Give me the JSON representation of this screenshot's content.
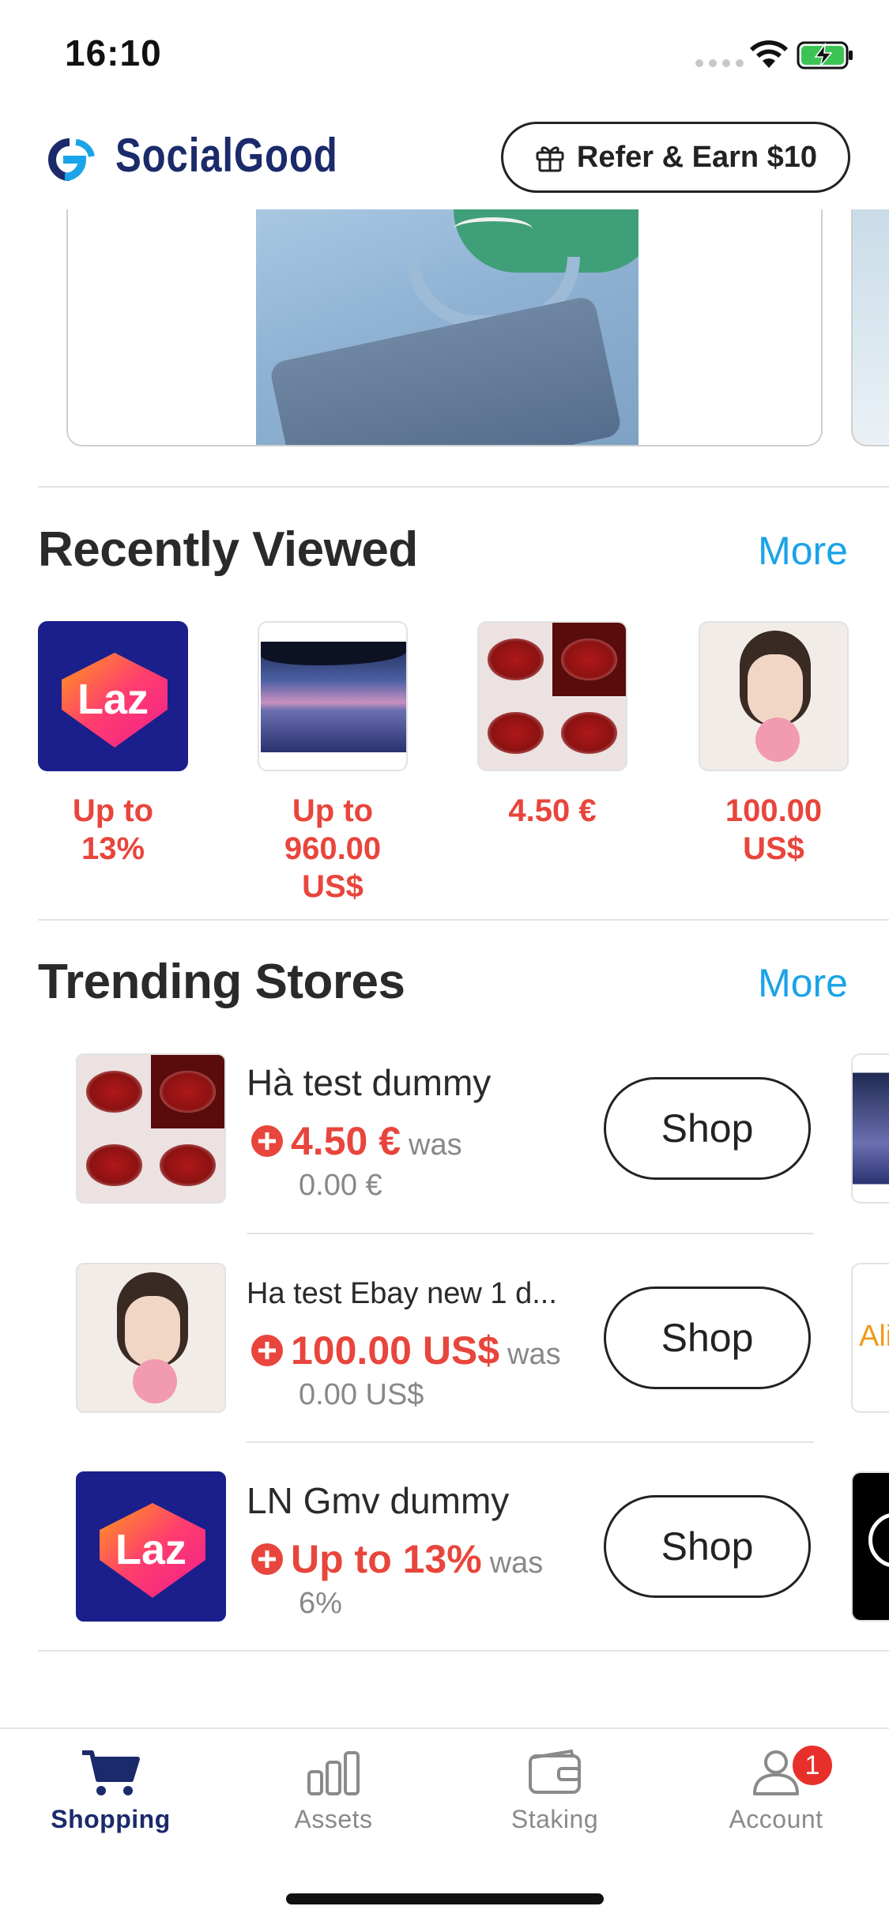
{
  "status_bar": {
    "time": "16:10"
  },
  "header": {
    "brand": "SocialGood",
    "refer_label": "Refer & Earn $10"
  },
  "recently_viewed": {
    "title": "Recently Viewed",
    "more_label": "More",
    "items": [
      {
        "thumb": "lazada-logo",
        "thumb_text": "Laz",
        "price": "Up to 13%"
      },
      {
        "thumb": "lake-sunset-photo",
        "price": "Up to 960.00 US$"
      },
      {
        "thumb": "red-lipstick-photo",
        "price": "4.50 €"
      },
      {
        "thumb": "woman-with-flower-photo",
        "price": "100.00 US$"
      }
    ]
  },
  "trending_stores": {
    "title": "Trending Stores",
    "more_label": "More",
    "stores": [
      {
        "thumb": "red-lipstick-photo",
        "name": "Hà test dummy",
        "price": "4.50 €",
        "was_label": "was",
        "old_price": "0.00 €",
        "shop_label": "Shop"
      },
      {
        "thumb": "woman-with-flower-photo",
        "name": "Ha test Ebay new 1 d...",
        "price": "100.00 US$",
        "was_label": "was",
        "old_price": "0.00 US$",
        "shop_label": "Shop"
      },
      {
        "thumb": "lazada-logo",
        "thumb_text": "Laz",
        "name": "LN Gmv dummy",
        "price": "Up to 13%",
        "was_label": "was",
        "old_price": "6%",
        "shop_label": "Shop"
      }
    ],
    "peek_text": "Ali"
  },
  "tab_bar": {
    "tabs": [
      {
        "label": "Shopping",
        "icon": "cart-icon",
        "active": true
      },
      {
        "label": "Assets",
        "icon": "bar-chart-icon",
        "active": false
      },
      {
        "label": "Staking",
        "icon": "wallet-icon",
        "active": false
      },
      {
        "label": "Account",
        "icon": "person-icon",
        "active": false,
        "badge": "1"
      }
    ]
  },
  "colors": {
    "brand_navy": "#1b2a6b",
    "accent_blue": "#1aa3e8",
    "price_red": "#e8453c",
    "badge_red": "#e8302a"
  }
}
